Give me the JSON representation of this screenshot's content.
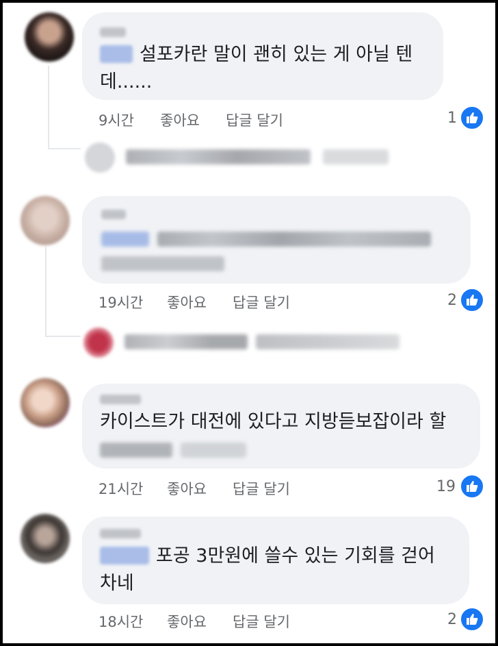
{
  "labels": {
    "like": "좋아요",
    "reply": "답글 달기"
  },
  "colors": {
    "bubble": "#f0f2f5",
    "meta": "#65676b",
    "like_badge": "#1877f2"
  },
  "comments": [
    {
      "lines": [
        "설포카란 말이 괜히 있는 게 아닐 텐",
        "데......"
      ],
      "time": "9시간",
      "likes": "1"
    },
    {
      "lines": [],
      "time": "19시간",
      "likes": "2"
    },
    {
      "lines": [
        "카이스트가 대전에 있다고 지방듣보잡이라 할"
      ],
      "time": "21시간",
      "likes": "19"
    },
    {
      "lines": [
        "포공 3만원에 쓸수 있는 기회를 걷어",
        "차네"
      ],
      "time": "18시간",
      "likes": "2"
    }
  ]
}
